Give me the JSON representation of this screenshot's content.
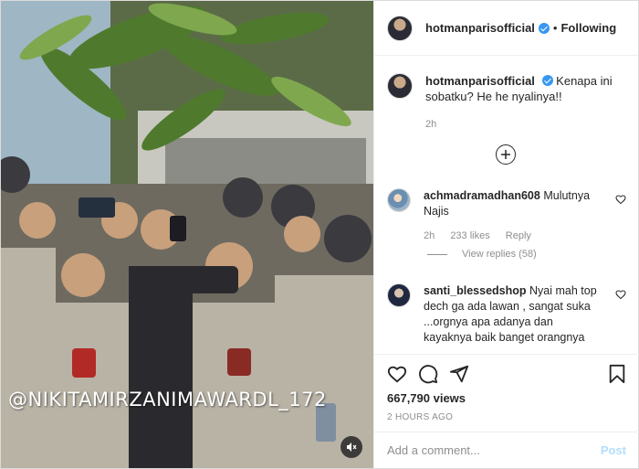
{
  "media": {
    "watermark": "@NIKITAMIRZANIMAWARDL_172"
  },
  "header": {
    "username": "hotmanparisofficial",
    "separator": "•",
    "follow_label": "Following"
  },
  "caption": {
    "username": "hotmanparisofficial",
    "text": "Kenapa ini sobatku? He he nyalinya!!",
    "time": "2h"
  },
  "comments": [
    {
      "username": "achmadramadhan608",
      "text": "Mulutnya Najis",
      "time": "2h",
      "likes": "233 likes",
      "reply_label": "Reply",
      "view_replies": "View replies (58)"
    },
    {
      "username": "santi_blessedshop",
      "text": "Nyai mah top dech ga ada lawan , sangat suka ...orgnya apa adanya dan kayaknya baik banget orangnya"
    }
  ],
  "actions": {
    "views": "667,790 views",
    "posted": "2 HOURS AGO"
  },
  "add_comment": {
    "placeholder": "Add a comment...",
    "post_label": "Post"
  },
  "icons": {
    "verified": "verified-badge-icon",
    "load_more": "plus-circle-icon",
    "like": "heart-icon",
    "comment": "comment-bubble-icon",
    "share": "paper-plane-icon",
    "save": "bookmark-icon",
    "mute": "speaker-muted-icon"
  },
  "colors": {
    "verified": "#3897f0",
    "post_button": "#b2dffc",
    "muted_text": "#8e8e8e"
  }
}
